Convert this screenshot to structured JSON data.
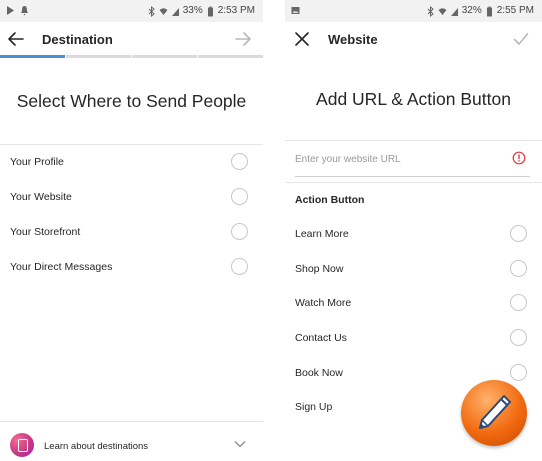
{
  "left_screen": {
    "status": {
      "battery": "33%",
      "time": "2:53 PM"
    },
    "nav": {
      "title": "Destination"
    },
    "heading": "Select Where to Send People",
    "options": [
      {
        "label": "Your Profile"
      },
      {
        "label": "Your Website"
      },
      {
        "label": "Your Storefront"
      },
      {
        "label": "Your Direct Messages"
      }
    ],
    "footer": {
      "label": "Learn about destinations"
    }
  },
  "right_screen": {
    "status": {
      "battery": "32%",
      "time": "2:55 PM"
    },
    "nav": {
      "title": "Website"
    },
    "heading": "Add URL & Action Button",
    "url_input": {
      "value": "",
      "placeholder": "Enter your website URL"
    },
    "section_title": "Action Button",
    "buttons": [
      {
        "label": "Learn More"
      },
      {
        "label": "Shop Now"
      },
      {
        "label": "Watch More"
      },
      {
        "label": "Contact Us"
      },
      {
        "label": "Book Now"
      },
      {
        "label": "Sign Up"
      }
    ]
  },
  "colors": {
    "progress_active": "#4a90d9",
    "warning": "#e0393e",
    "badge": "#f26a10"
  },
  "icons": [
    "play-icon",
    "bluetooth-icon",
    "wifi-icon",
    "signal-icon",
    "battery-icon",
    "back-arrow-icon",
    "forward-arrow-icon",
    "close-icon",
    "check-icon",
    "warning-icon",
    "chevron-down-icon",
    "pencil-icon"
  ]
}
